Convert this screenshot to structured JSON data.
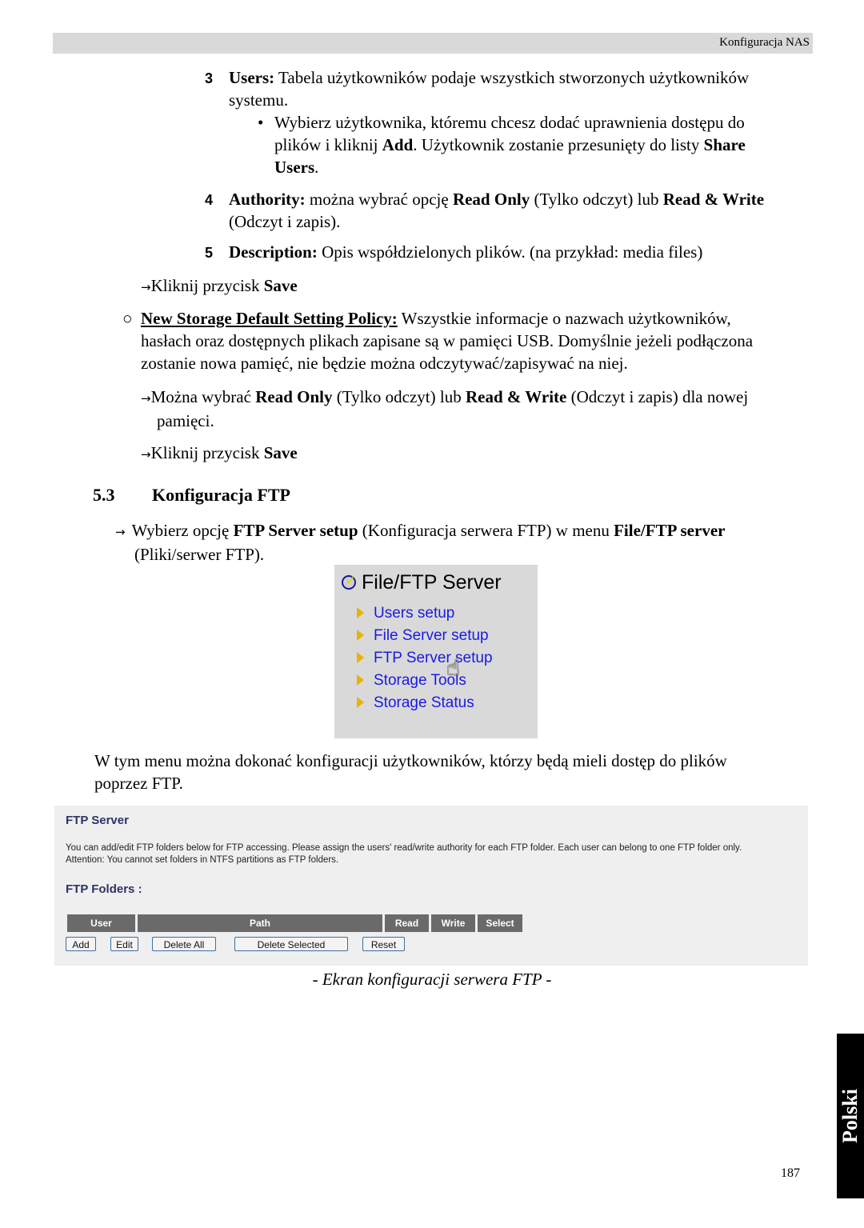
{
  "header": {
    "section": "Konfiguracja NAS"
  },
  "items": {
    "item3": {
      "num": "3",
      "label": "Users:",
      "text1": " Tabela użytkowników podaje wszystkich stworzonych użytkowników",
      "text2": "systemu."
    },
    "bullet": {
      "pre": "Wybierz użytkownika, któremu chcesz dodać uprawnienia dostępu do",
      "pre2": "plików i kliknij ",
      "add": "Add",
      "mid": ". Użytkownik zostanie przesunięty do listy ",
      "share": "Share",
      "users": "Users",
      "end": "."
    },
    "item4": {
      "num": "4",
      "label": "Authority:",
      "t1": " można wybrać opcję ",
      "ro": "Read Only",
      "t2": " (Tylko odczyt) lub ",
      "rw": "Read & Write",
      "t3": "(Odczyt i zapis)."
    },
    "item5": {
      "num": "5",
      "label": "Description:",
      "text": " Opis współdzielonych plików. (na przykład: media files)"
    },
    "save1": {
      "text": "Kliknij przycisk ",
      "save": "Save"
    }
  },
  "policy": {
    "label": "New Storage Default Setting Policy:",
    "line1": " Wszystkie informacje o nazwach użytkowników,",
    "line2": "hasłach oraz dostępnych plikach zapisane są w pamięci USB. Domyślnie jeżeli podłączona",
    "line3": "zostanie nowa pamięć, nie będzie można odczytywać/zapisywać na niej.",
    "choose": {
      "t1": "Można wybrać ",
      "ro": "Read Only",
      "t2": " (Tylko odczyt) lub ",
      "rw": "Read & Write",
      "t3": " (Odczyt i zapis) dla nowej",
      "t4": "pamięci."
    },
    "save2": {
      "text": "Kliknij przycisk ",
      "save": "Save"
    }
  },
  "section": {
    "number": "5.3",
    "title": "Konfiguracja FTP",
    "instr": {
      "t1": "Wybierz opcję ",
      "b1": "FTP Server setup",
      "t2": " (Konfiguracja serwera FTP) w menu ",
      "b2": "File/FTP server",
      "t3": "(Pliki/serwer FTP)."
    }
  },
  "menu": {
    "title": "File/FTP Server",
    "items": [
      "Users setup",
      "File Server setup",
      "FTP Server setup",
      "Storage Tools",
      "Storage Status"
    ]
  },
  "para": {
    "line1": "W tym menu można dokonać konfiguracji użytkowników, którzy będą mieli dostęp do plików",
    "line2": "poprzez FTP."
  },
  "ftp": {
    "title": "FTP Server",
    "desc1": "You can add/edit FTP folders below for FTP accessing. Please assign the users' read/write authority for each FTP folder. Each user can belong to one FTP folder only.",
    "desc2": "Attention: You cannot set folders in NTFS partitions as FTP folders.",
    "folders_label": "FTP Folders  :",
    "columns": [
      "User",
      "Path",
      "Read",
      "Write",
      "Select"
    ],
    "buttons": [
      "Add",
      "Edit",
      "Delete All",
      "Delete Selected",
      "Reset"
    ]
  },
  "caption": "- Ekran konfiguracji serwera FTP -",
  "side_tab": "Polski",
  "page_number": "187",
  "colors": {
    "menu_link": "#1a1ae6",
    "ftp_heading": "#2e3466",
    "table_header": "#6a6a6a",
    "menu_bg": "#d9d9d9",
    "panel_bg": "#efefef"
  }
}
